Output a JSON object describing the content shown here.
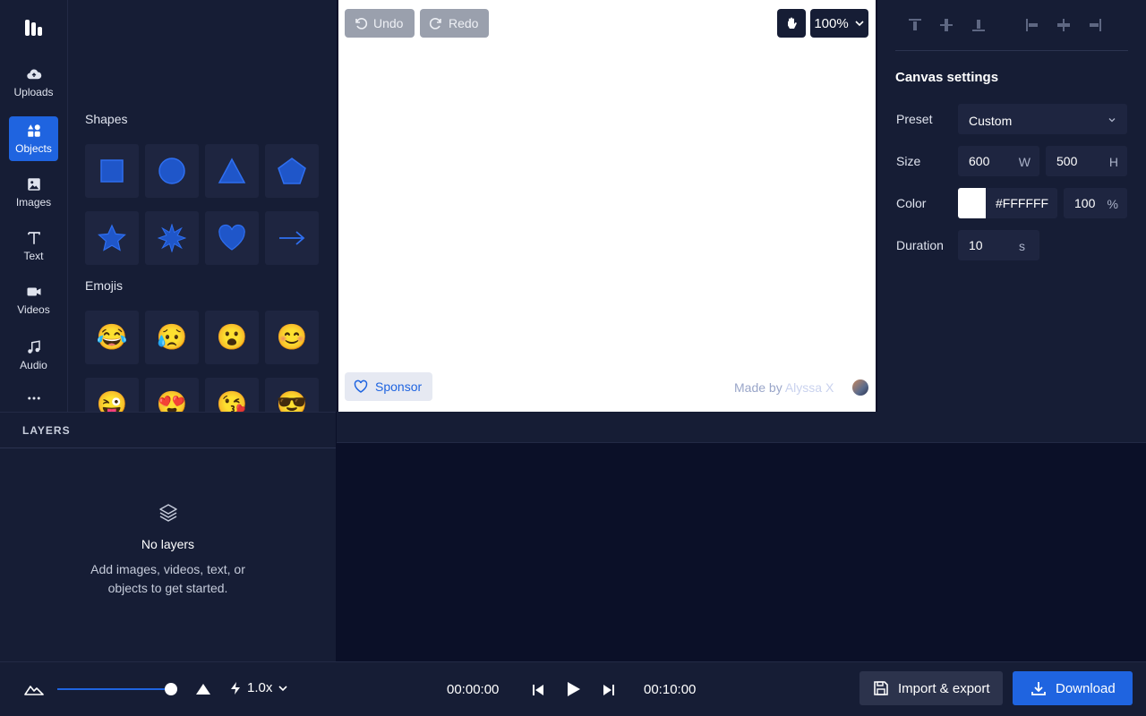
{
  "rail": {
    "items": [
      {
        "label": "Uploads",
        "icon": "cloud-upload-icon"
      },
      {
        "label": "Objects",
        "icon": "objects-grid-icon"
      },
      {
        "label": "Images",
        "icon": "image-icon"
      },
      {
        "label": "Text",
        "icon": "text-t-icon"
      },
      {
        "label": "Videos",
        "icon": "video-camera-icon"
      },
      {
        "label": "Audio",
        "icon": "music-note-icon"
      }
    ],
    "more_icon": "more-horizontal-icon"
  },
  "objects": {
    "shapes_title": "Shapes",
    "shapes": [
      "square",
      "circle",
      "triangle",
      "pentagon",
      "star",
      "burst",
      "heart",
      "arrow"
    ],
    "emojis_title": "Emojis",
    "emojis": [
      "😂",
      "😥",
      "😮",
      "😊",
      "😜",
      "😍",
      "😘",
      "😎"
    ]
  },
  "canvas": {
    "undo_label": "Undo",
    "redo_label": "Redo",
    "zoom_label": "100%",
    "sponsor_label": "Sponsor",
    "made_by_prefix": "Made by",
    "made_by_name": "Alyssa X"
  },
  "settings": {
    "title": "Canvas settings",
    "preset_label": "Preset",
    "preset_value": "Custom",
    "size_label": "Size",
    "width_value": "600",
    "width_suffix": "W",
    "height_value": "500",
    "height_suffix": "H",
    "color_label": "Color",
    "color_hex": "#FFFFFF",
    "opacity_value": "100",
    "opacity_suffix": "%",
    "duration_label": "Duration",
    "duration_value": "10",
    "duration_suffix": "s"
  },
  "layers": {
    "header": "LAYERS",
    "empty_title": "No layers",
    "empty_text": "Add images, videos, text, or objects to get started."
  },
  "playback": {
    "speed_label": "1.0x",
    "zoom_level": 0.95,
    "current_time": "00:00:00",
    "total_time": "00:10:00",
    "import_label": "Import & export",
    "download_label": "Download"
  },
  "colors": {
    "accent": "#1f64e0",
    "panel": "#161d35",
    "background": "#0b1028"
  }
}
